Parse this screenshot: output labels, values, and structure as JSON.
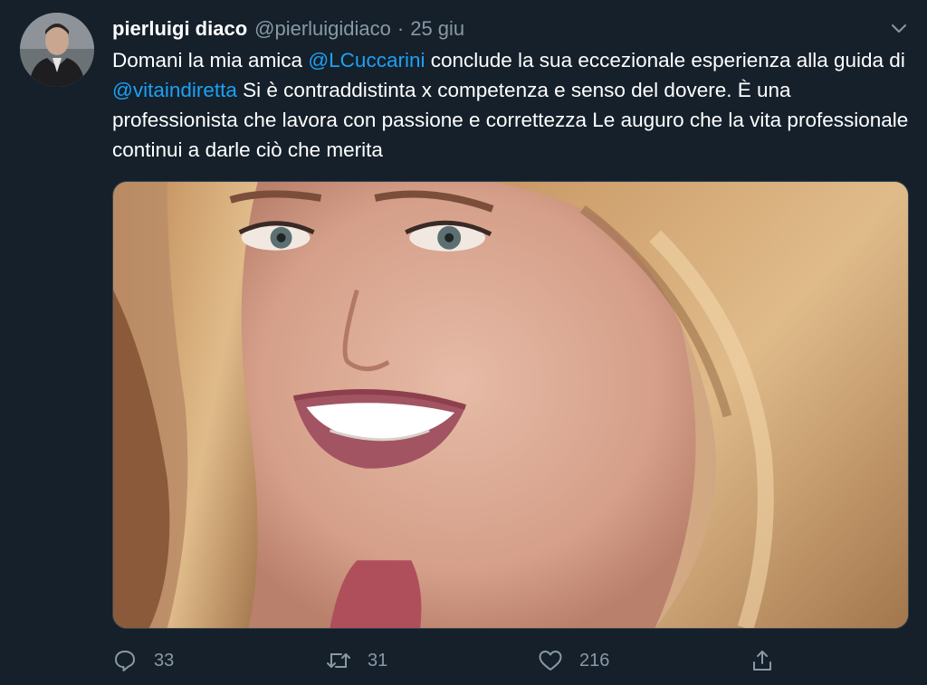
{
  "tweet": {
    "author_name": "pierluigi diaco",
    "author_handle": "@pierluigidiaco",
    "separator": "·",
    "date": "25 giu",
    "text": {
      "p1": "Domani la mia amica ",
      "mention1": "@LCuccarini",
      "p2": " conclude la sua eccezionale esperienza alla guida di ",
      "mention2": "@vitaindiretta",
      "p3": " Si è contraddistinta x competenza e senso del dovere. È una professionista che lavora con passione e correttezza Le auguro che la vita professionale continui a darle ciò che merita"
    },
    "media_icon": "photo-of-smiling-woman",
    "actions": {
      "reply_count": "33",
      "retweet_count": "31",
      "like_count": "216"
    }
  },
  "colors": {
    "background": "#15202b",
    "text": "#ffffff",
    "secondary": "#8899a6",
    "link": "#1da1f2"
  }
}
